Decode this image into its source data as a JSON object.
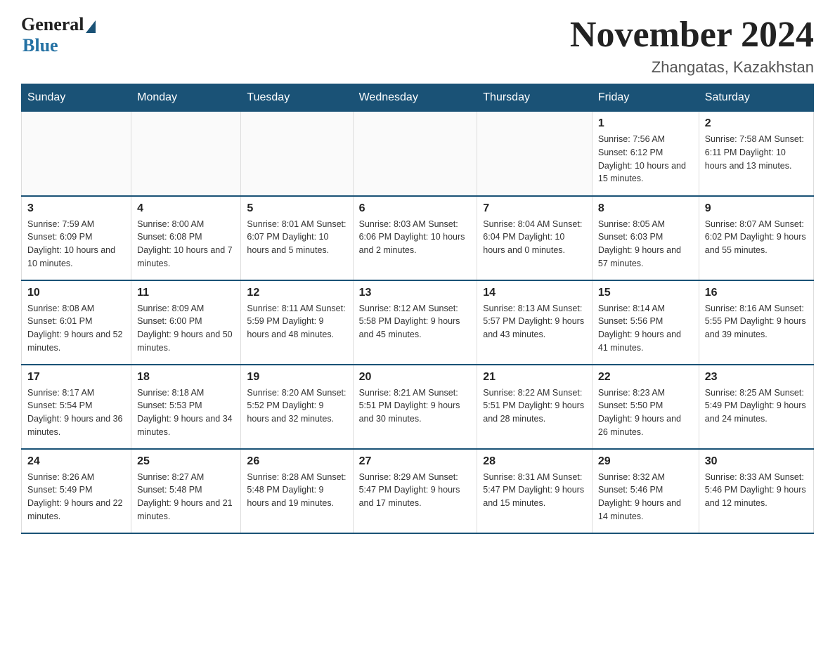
{
  "header": {
    "logo_general": "General",
    "logo_blue": "Blue",
    "title": "November 2024",
    "subtitle": "Zhangatas, Kazakhstan"
  },
  "days_of_week": [
    "Sunday",
    "Monday",
    "Tuesday",
    "Wednesday",
    "Thursday",
    "Friday",
    "Saturday"
  ],
  "weeks": [
    [
      {
        "day": "",
        "info": ""
      },
      {
        "day": "",
        "info": ""
      },
      {
        "day": "",
        "info": ""
      },
      {
        "day": "",
        "info": ""
      },
      {
        "day": "",
        "info": ""
      },
      {
        "day": "1",
        "info": "Sunrise: 7:56 AM\nSunset: 6:12 PM\nDaylight: 10 hours\nand 15 minutes."
      },
      {
        "day": "2",
        "info": "Sunrise: 7:58 AM\nSunset: 6:11 PM\nDaylight: 10 hours\nand 13 minutes."
      }
    ],
    [
      {
        "day": "3",
        "info": "Sunrise: 7:59 AM\nSunset: 6:09 PM\nDaylight: 10 hours\nand 10 minutes."
      },
      {
        "day": "4",
        "info": "Sunrise: 8:00 AM\nSunset: 6:08 PM\nDaylight: 10 hours\nand 7 minutes."
      },
      {
        "day": "5",
        "info": "Sunrise: 8:01 AM\nSunset: 6:07 PM\nDaylight: 10 hours\nand 5 minutes."
      },
      {
        "day": "6",
        "info": "Sunrise: 8:03 AM\nSunset: 6:06 PM\nDaylight: 10 hours\nand 2 minutes."
      },
      {
        "day": "7",
        "info": "Sunrise: 8:04 AM\nSunset: 6:04 PM\nDaylight: 10 hours\nand 0 minutes."
      },
      {
        "day": "8",
        "info": "Sunrise: 8:05 AM\nSunset: 6:03 PM\nDaylight: 9 hours\nand 57 minutes."
      },
      {
        "day": "9",
        "info": "Sunrise: 8:07 AM\nSunset: 6:02 PM\nDaylight: 9 hours\nand 55 minutes."
      }
    ],
    [
      {
        "day": "10",
        "info": "Sunrise: 8:08 AM\nSunset: 6:01 PM\nDaylight: 9 hours\nand 52 minutes."
      },
      {
        "day": "11",
        "info": "Sunrise: 8:09 AM\nSunset: 6:00 PM\nDaylight: 9 hours\nand 50 minutes."
      },
      {
        "day": "12",
        "info": "Sunrise: 8:11 AM\nSunset: 5:59 PM\nDaylight: 9 hours\nand 48 minutes."
      },
      {
        "day": "13",
        "info": "Sunrise: 8:12 AM\nSunset: 5:58 PM\nDaylight: 9 hours\nand 45 minutes."
      },
      {
        "day": "14",
        "info": "Sunrise: 8:13 AM\nSunset: 5:57 PM\nDaylight: 9 hours\nand 43 minutes."
      },
      {
        "day": "15",
        "info": "Sunrise: 8:14 AM\nSunset: 5:56 PM\nDaylight: 9 hours\nand 41 minutes."
      },
      {
        "day": "16",
        "info": "Sunrise: 8:16 AM\nSunset: 5:55 PM\nDaylight: 9 hours\nand 39 minutes."
      }
    ],
    [
      {
        "day": "17",
        "info": "Sunrise: 8:17 AM\nSunset: 5:54 PM\nDaylight: 9 hours\nand 36 minutes."
      },
      {
        "day": "18",
        "info": "Sunrise: 8:18 AM\nSunset: 5:53 PM\nDaylight: 9 hours\nand 34 minutes."
      },
      {
        "day": "19",
        "info": "Sunrise: 8:20 AM\nSunset: 5:52 PM\nDaylight: 9 hours\nand 32 minutes."
      },
      {
        "day": "20",
        "info": "Sunrise: 8:21 AM\nSunset: 5:51 PM\nDaylight: 9 hours\nand 30 minutes."
      },
      {
        "day": "21",
        "info": "Sunrise: 8:22 AM\nSunset: 5:51 PM\nDaylight: 9 hours\nand 28 minutes."
      },
      {
        "day": "22",
        "info": "Sunrise: 8:23 AM\nSunset: 5:50 PM\nDaylight: 9 hours\nand 26 minutes."
      },
      {
        "day": "23",
        "info": "Sunrise: 8:25 AM\nSunset: 5:49 PM\nDaylight: 9 hours\nand 24 minutes."
      }
    ],
    [
      {
        "day": "24",
        "info": "Sunrise: 8:26 AM\nSunset: 5:49 PM\nDaylight: 9 hours\nand 22 minutes."
      },
      {
        "day": "25",
        "info": "Sunrise: 8:27 AM\nSunset: 5:48 PM\nDaylight: 9 hours\nand 21 minutes."
      },
      {
        "day": "26",
        "info": "Sunrise: 8:28 AM\nSunset: 5:48 PM\nDaylight: 9 hours\nand 19 minutes."
      },
      {
        "day": "27",
        "info": "Sunrise: 8:29 AM\nSunset: 5:47 PM\nDaylight: 9 hours\nand 17 minutes."
      },
      {
        "day": "28",
        "info": "Sunrise: 8:31 AM\nSunset: 5:47 PM\nDaylight: 9 hours\nand 15 minutes."
      },
      {
        "day": "29",
        "info": "Sunrise: 8:32 AM\nSunset: 5:46 PM\nDaylight: 9 hours\nand 14 minutes."
      },
      {
        "day": "30",
        "info": "Sunrise: 8:33 AM\nSunset: 5:46 PM\nDaylight: 9 hours\nand 12 minutes."
      }
    ]
  ]
}
